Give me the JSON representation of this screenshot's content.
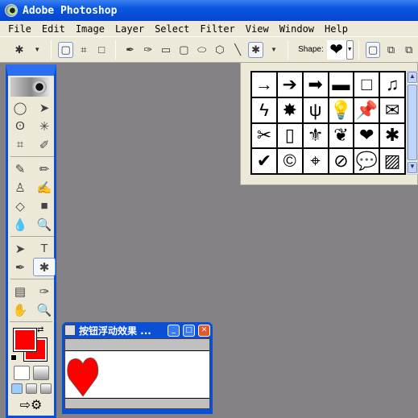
{
  "app": {
    "title": "Adobe Photoshop"
  },
  "menu": [
    "File",
    "Edit",
    "Image",
    "Layer",
    "Select",
    "Filter",
    "View",
    "Window",
    "Help"
  ],
  "options": {
    "shape_label": "Shape:",
    "shape_value": "heart"
  },
  "shape_picker": {
    "shapes": [
      "→",
      "➔",
      "➡",
      "▬",
      "□",
      "♫",
      "ϟ",
      "✸",
      "ψ",
      "💡",
      "📌",
      "✉",
      "✂",
      "▯",
      "⚜",
      "❦",
      "❤",
      "✱",
      "✔",
      "©",
      "⌖",
      "⊘",
      "💬",
      "▨"
    ]
  },
  "tools": [
    "◯",
    "➤",
    "ʘ",
    "✳",
    "⌗",
    "✐",
    "✎",
    "✏",
    "♙",
    "✍",
    "◇",
    "■",
    "💧",
    "🔍",
    "➤",
    "T",
    "✒",
    "✱",
    "▤",
    "✑",
    "✋",
    "🔍"
  ],
  "colors": {
    "foreground": "#ff0000",
    "background": "#ff0000"
  },
  "document": {
    "title": "按钮浮动效果 ..."
  }
}
